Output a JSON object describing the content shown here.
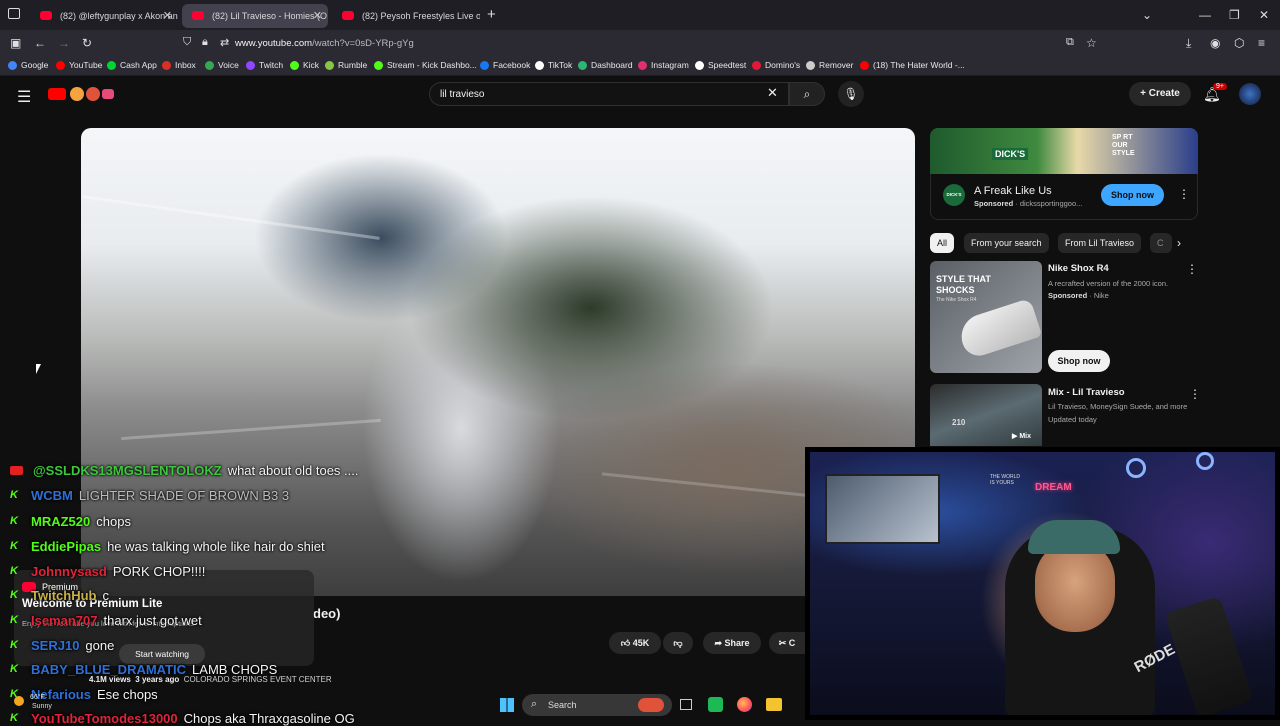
{
  "browser": {
    "tabs": [
      {
        "label": "(82) @leftygunplay x Akon and"
      },
      {
        "label": "(82) Lil Travieso - Homies (O"
      },
      {
        "label": "(82) Peysoh Freestyles Live on P"
      }
    ],
    "url_domain": "www.youtube.com",
    "url_path": "/watch?v=0sD-YRp-gYg",
    "bookmarks": [
      {
        "label": "Google",
        "color": "#4285f4"
      },
      {
        "label": "YouTube",
        "color": "#ff0000"
      },
      {
        "label": "Cash App",
        "color": "#00d632"
      },
      {
        "label": "Inbox",
        "color": "#d93025"
      },
      {
        "label": "Voice",
        "color": "#34a853"
      },
      {
        "label": "Twitch",
        "color": "#9146ff"
      },
      {
        "label": "Kick",
        "color": "#53fc18"
      },
      {
        "label": "Rumble",
        "color": "#85c742"
      },
      {
        "label": "Stream - Kick Dashbo...",
        "color": "#53fc18"
      },
      {
        "label": "Facebook",
        "color": "#1877f2"
      },
      {
        "label": "TikTok",
        "color": "#ffffff"
      },
      {
        "label": "Dashboard",
        "color": "#2bb673"
      },
      {
        "label": "Instagram",
        "color": "#e1306c"
      },
      {
        "label": "Speedtest",
        "color": "#ffffff"
      },
      {
        "label": "Domino's",
        "color": "#e31837"
      },
      {
        "label": "Remover",
        "color": "#cccccc"
      },
      {
        "label": "(18) The Hater World -...",
        "color": "#ff0000"
      }
    ]
  },
  "youtube": {
    "search_query": "lil travieso",
    "create_label": "Create",
    "notification_count": "9+",
    "video_title_fragment": "deo)",
    "like_count": "45K",
    "share_label": "Share",
    "clip_label": "C",
    "stats_views": "4.1M views",
    "stats_age": "3 years ago",
    "stats_location": "COLORADO SPRINGS EVENT CENTER"
  },
  "sidebar": {
    "ad": {
      "banner_brand": "DICK'S",
      "banner_slogan": "SP RT OUR STYLE",
      "title": "A Freak Like Us",
      "sponsored": "Sponsored",
      "domain": "dickssportinggoo...",
      "cta": "Shop now",
      "logo_text": "DICK'S"
    },
    "chips": [
      "All",
      "From your search",
      "From Lil Travieso",
      "C"
    ],
    "nike": {
      "title": "Nike Shox R4",
      "desc": "A recrafted version of the 2000 icon.",
      "sponsored": "Sponsored",
      "brand": "Nike",
      "thumb_text_1": "STYLE THAT",
      "thumb_text_2": "SHOCKS",
      "thumb_small": "The Nike Shox R4",
      "cta": "Shop now"
    },
    "mix": {
      "title": "Mix - Lil Travieso",
      "artists": "Lil Travieso, MoneySign Suede, and more",
      "updated": "Updated today",
      "badge": "Mix",
      "jersey": "210"
    }
  },
  "chat": [
    {
      "source": "yt",
      "user": "@SSLDKS13MGSLENTOLOKZ",
      "user_color": "#3cc73c",
      "msg": "what about old toes ...."
    },
    {
      "source": "kick",
      "user": "WCBM",
      "user_color": "#2e6fd8",
      "msg": "LIGHTER SHADE OF BROWN B3 3"
    },
    {
      "source": "kick",
      "user": "MRAZ520",
      "user_color": "#53fc18",
      "msg": "chops"
    },
    {
      "source": "kick",
      "user": "EddiePipas",
      "user_color": "#53fc18",
      "msg": "he was talking whole like hair do shiet"
    },
    {
      "source": "kick",
      "user": "Johnnysasd",
      "user_color": "#e0243a",
      "msg": "PORK CHOP!!!!"
    },
    {
      "source": "kick",
      "user": "TwitchHub",
      "user_color": "#c8b24a",
      "msg": "c"
    },
    {
      "source": "kick",
      "user": "Iseman707",
      "user_color": "#e0243a",
      "msg": "tharx just got wet"
    },
    {
      "source": "kick",
      "user": "SERJ10",
      "user_color": "#2e6fd8",
      "msg": "gone"
    },
    {
      "source": "kick",
      "user": "BABY_BLUE_DRAMATIC",
      "user_color": "#2e6fd8",
      "msg": "LAMB CHOPS"
    },
    {
      "source": "kick",
      "user": "Nefarious",
      "user_color": "#2e6fd8",
      "msg": "Ese chops"
    },
    {
      "source": "kick",
      "user": "YouTubeTomodes13000",
      "user_color": "#e0243a",
      "msg": "Chops aka Thraxgasoline OG"
    }
  ],
  "premium_popup": {
    "label": "Premium",
    "title": "Welcome to Premium Lite",
    "body": "Enjoy the YouTube you love with fewer interruptions",
    "cta": "Start watching"
  },
  "taskbar": {
    "weather_temp": "66°F",
    "weather_desc": "Sunny",
    "search_label": "Search"
  },
  "webcam": {
    "mic_brand": "RØDE",
    "poster_text": "THE WORLD IS YOURS",
    "neon_text": "DREAM"
  }
}
